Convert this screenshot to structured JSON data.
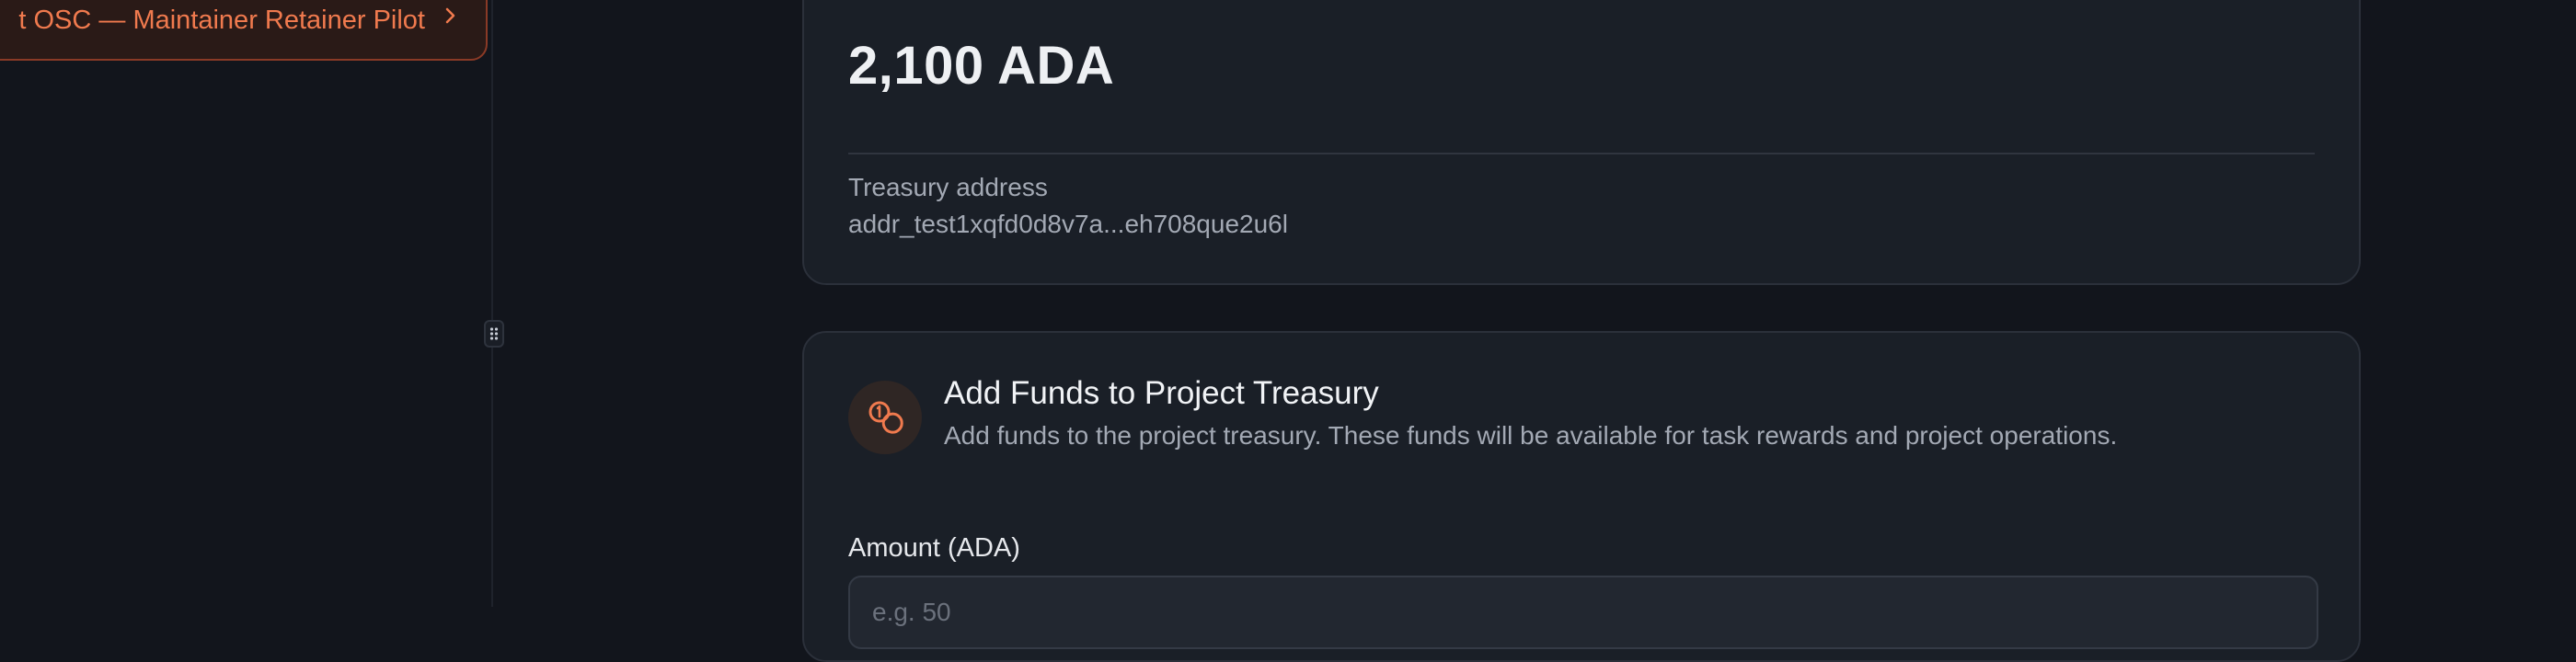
{
  "sidebar": {
    "active_item": {
      "label": "t OSC — Maintainer Retainer Pilot"
    }
  },
  "treasury_card": {
    "balance": "2,100 ADA",
    "address_label": "Treasury address",
    "address": "addr_test1xqfd0d8v7a...eh708que2u6l"
  },
  "add_funds": {
    "title": "Add Funds to Project Treasury",
    "description": "Add funds to the project treasury. These funds will be available for task rewards and project operations.",
    "amount_label": "Amount (ADA)",
    "amount_placeholder": "e.g. 50",
    "amount_value": ""
  },
  "colors": {
    "accent": "#f07a4e",
    "background": "#12151c",
    "card": "#1a1f27"
  },
  "icons": {
    "chevron": "chevron-right-icon",
    "coins": "coins-icon",
    "resize": "grip-vertical-icon"
  }
}
